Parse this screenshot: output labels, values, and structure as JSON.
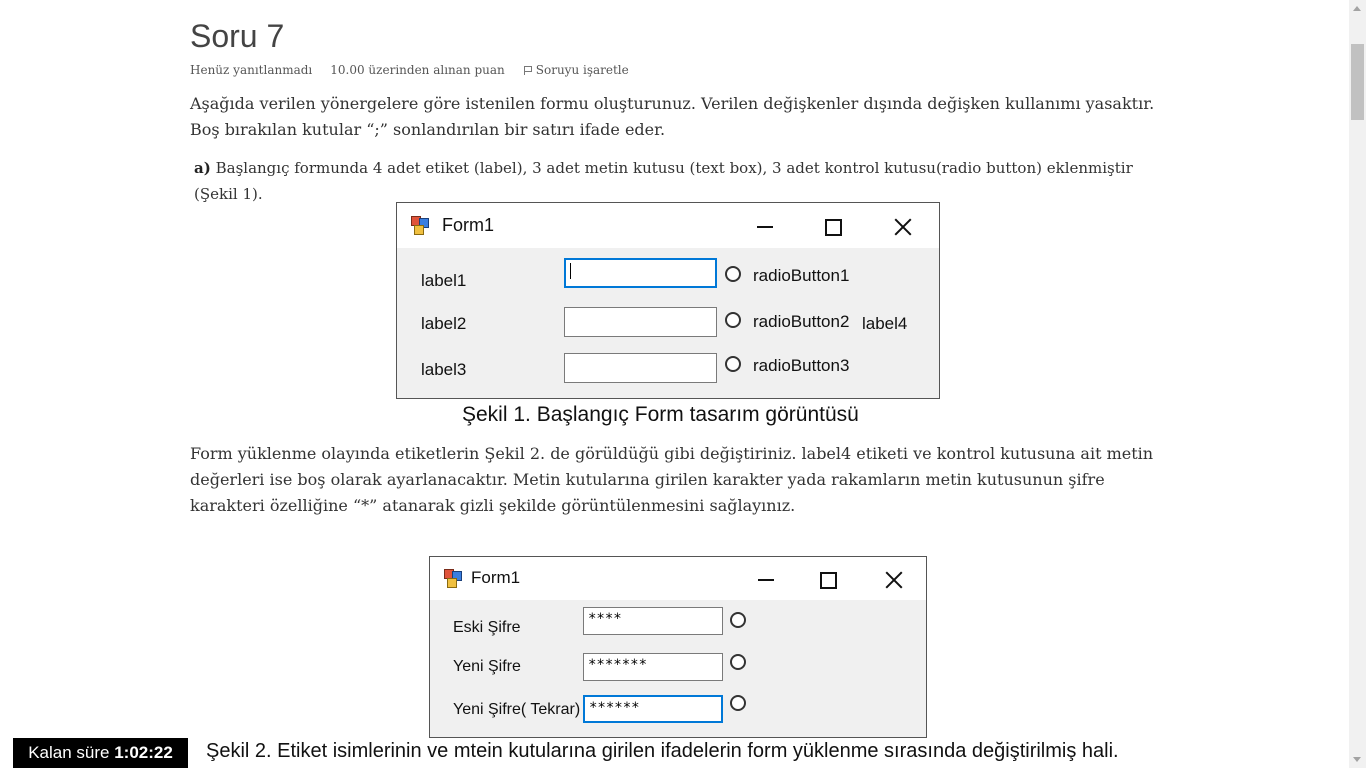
{
  "question": {
    "title": "Soru 7",
    "status": "Henüz yanıtlanmadı",
    "points": "10.00 üzerinden alınan puan",
    "flag_label": "Soruyu işaretle"
  },
  "text": {
    "intro": "Aşağıda verilen yönergelere göre istenilen formu oluşturunuz. Verilen değişkenler dışında değişken kullanımı yasaktır. Boş bırakılan kutular “;” sonlandırılan bir satırı ifade eder.",
    "part_a_label": "a)",
    "part_a_text": "Başlangıç formunda 4 adet etiket (label), 3 adet metin kutusu (text box), 3 adet kontrol kutusu(radio button) eklenmiştir (Şekil 1).",
    "instructions": "Form yüklenme olayında etiketlerin Şekil 2. de görüldüğü gibi değiştiriniz. label4 etiketi ve kontrol kutusuna ait metin değerleri ise boş olarak ayarlanacaktır. Metin kutularına girilen karakter yada rakamların metin kutusunun şifre karakteri özelliğine “*” atanarak gizli şekilde görüntülenmesini sağlayınız."
  },
  "figure1": {
    "window_title": "Form1",
    "labels": [
      "label1",
      "label2",
      "label3",
      "label4"
    ],
    "radios": [
      "radioButton1",
      "radioButton2",
      "radioButton3"
    ],
    "caption": "Şekil 1. Başlangıç Form tasarım görüntüsü"
  },
  "figure2": {
    "window_title": "Form1",
    "labels": [
      "Eski Şifre",
      "Yeni Şifre",
      "Yeni Şifre( Tekrar)"
    ],
    "passwords": [
      "****",
      "*******",
      "******"
    ],
    "caption": "Şekil 2. Etiket isimlerinin ve mtein kutularına girilen ifadelerin form yüklenme sırasında değiştirilmiş hali."
  },
  "timer": {
    "label": "Kalan süre",
    "value": "1:02:22"
  }
}
